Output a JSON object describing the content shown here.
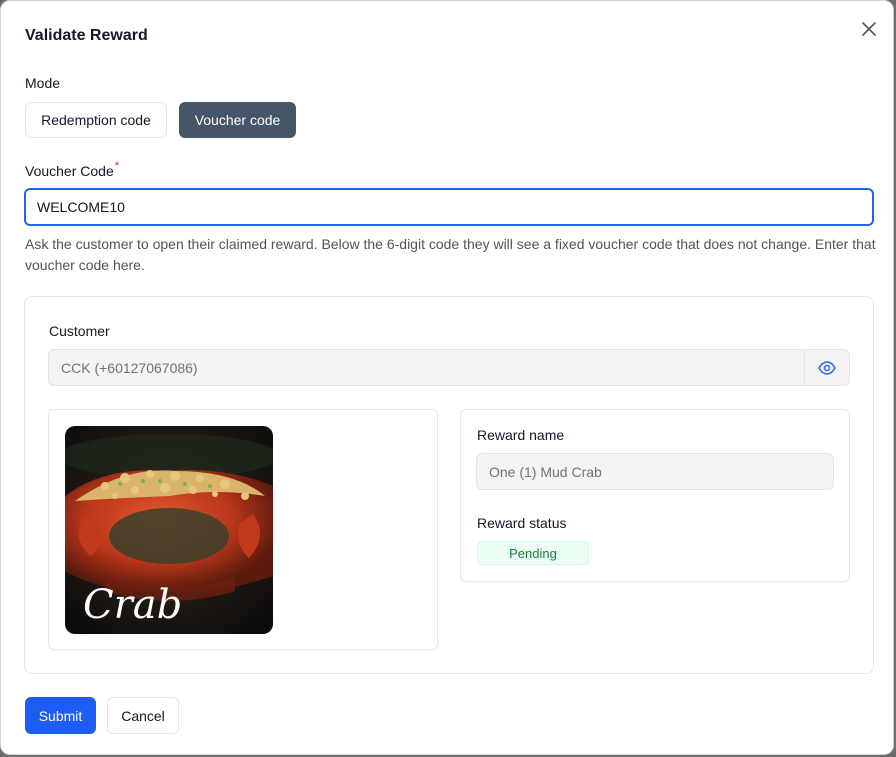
{
  "dialog": {
    "title": "Validate Reward",
    "close_icon": "close-icon"
  },
  "mode": {
    "label": "Mode",
    "options": [
      "Redemption code",
      "Voucher code"
    ],
    "selected": "Voucher code"
  },
  "voucher": {
    "label": "Voucher Code",
    "required_mark": "*",
    "value": "WELCOME10",
    "help": "Ask the customer to open their claimed reward. Below the 6-digit code they will see a fixed voucher code that does not change. Enter that voucher code here."
  },
  "customer": {
    "label": "Customer",
    "value": "CCK (+60127067086)",
    "toggle_icon": "eye-icon"
  },
  "reward": {
    "image_script_text": "Crab",
    "name_label": "Reward name",
    "name_value": "One (1) Mud Crab",
    "status_label": "Reward status",
    "status_value": "Pending"
  },
  "actions": {
    "submit": "Submit",
    "cancel": "Cancel"
  },
  "colors": {
    "primary": "#1d5cf5",
    "mode_active": "#475569",
    "focus_border": "#2563eb",
    "status_pending_bg": "#ecfdf3",
    "status_pending_text": "#15803d",
    "required": "#dc2626"
  }
}
